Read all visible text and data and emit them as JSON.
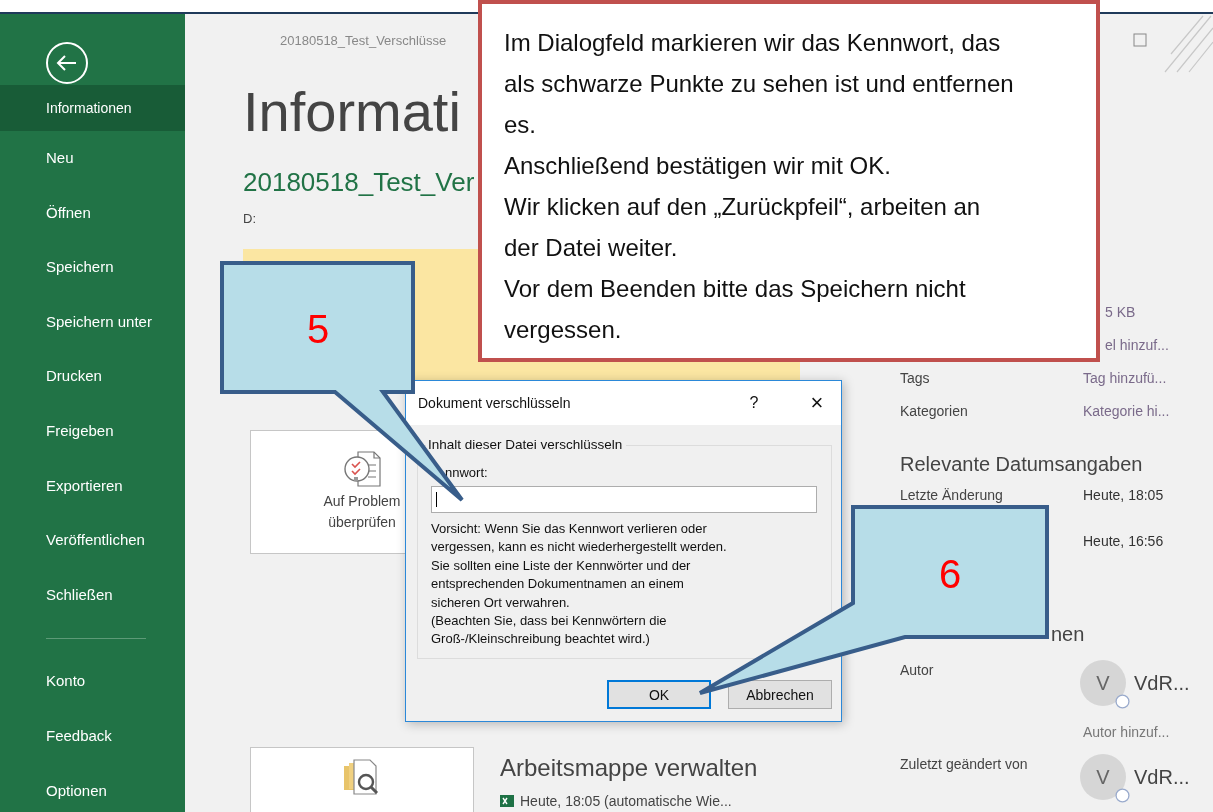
{
  "window": {
    "title": "20180518_Test_Verschlüsse"
  },
  "sidebar": {
    "items": [
      {
        "label": "Informationen",
        "selected": true
      },
      {
        "label": "Neu",
        "selected": false
      },
      {
        "label": "Öffnen",
        "selected": false
      },
      {
        "label": "Speichern",
        "selected": false
      },
      {
        "label": "Speichern unter",
        "selected": false
      },
      {
        "label": "Drucken",
        "selected": false
      },
      {
        "label": "Freigeben",
        "selected": false
      },
      {
        "label": "Exportieren",
        "selected": false
      },
      {
        "label": "Veröffentlichen",
        "selected": false
      },
      {
        "label": "Schließen",
        "selected": false
      }
    ],
    "footer_items": [
      {
        "label": "Konto",
        "selected": false
      },
      {
        "label": "Feedback",
        "selected": false
      },
      {
        "label": "Optionen",
        "selected": false
      }
    ]
  },
  "page": {
    "heading": "Informati",
    "file_name": "20180518_Test_Ver",
    "path": "D:"
  },
  "cards": [
    {
      "kind": "inspect",
      "lines": [
        "Auf Problem",
        "überprüfen"
      ]
    },
    {
      "kind": "manage",
      "title": "Arbeitsmappe verwalten",
      "detail": "Heute, 18:05 (automatische Wie..."
    }
  ],
  "properties": {
    "cut_values": [
      "5 KB",
      "el hinzuf..."
    ],
    "rows": [
      {
        "label": "Tags",
        "value": "Tag hinzufü..."
      },
      {
        "label": "Kategorien",
        "value": "Kategorie hi..."
      }
    ],
    "dates_heading": "Relevante Datumsangaben",
    "dates": [
      {
        "label": "Letzte Änderung",
        "value": "Heute, 18:05"
      },
      {
        "value": "Heute, 16:56"
      }
    ],
    "people_heading": "nen",
    "people": [
      {
        "label": "Autor",
        "initial": "V",
        "name": "VdR...",
        "add": "Autor hinzuf..."
      },
      {
        "label": "Zuletzt geändert von",
        "initial": "V",
        "name": "VdR..."
      }
    ]
  },
  "dialog": {
    "title": "Dokument verschlüsseln",
    "help": "?",
    "close": "×",
    "group_label": "Inhalt dieser Datei verschlüsseln",
    "field_label": "nnwort:",
    "warning": "Vorsicht: Wenn Sie das Kennwort verlieren oder\nvergessen, kann es nicht wiederhergestellt werden.\nSie sollten eine Liste der Kennwörter und der\nentsprechenden Dokumentnamen an einem\nsicheren Ort verwahren.\n(Beachten Sie, dass bei Kennwörtern die\nGroß-/Kleinschreibung beachtet wird.)",
    "buttons": [
      {
        "label": "OK",
        "selected": true
      },
      {
        "label": "Abbrechen",
        "selected": false
      }
    ]
  },
  "note": {
    "paragraphs": [
      "Im Dialogfeld markieren wir das Kennwort, das als schwarze Punkte zu sehen ist und entfernen es.",
      "Anschließend bestätigen wir mit OK.",
      "Wir klicken auf den „Zurückpfeil“, arbeiten an der Datei weiter.",
      "Vor dem Beenden bitte das Speichern nicht vergessen."
    ]
  },
  "callouts": [
    {
      "number": "5"
    },
    {
      "number": "6"
    }
  ]
}
